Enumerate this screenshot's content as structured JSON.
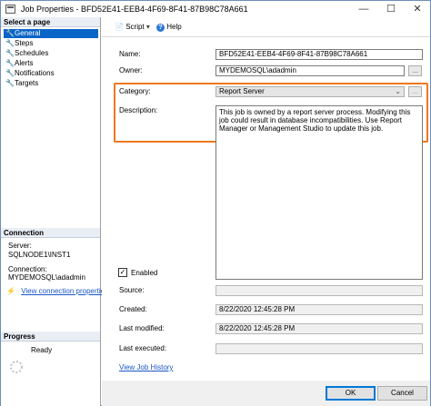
{
  "window": {
    "title": "Job Properties - BFD52E41-EEB4-4F69-8F41-87B98C78A661",
    "minimize": "—",
    "maximize": "☐",
    "close": "✕"
  },
  "left_pane": {
    "select_page_header": "Select a page",
    "pages": [
      {
        "label": "General",
        "selected": true
      },
      {
        "label": "Steps",
        "selected": false
      },
      {
        "label": "Schedules",
        "selected": false
      },
      {
        "label": "Alerts",
        "selected": false
      },
      {
        "label": "Notifications",
        "selected": false
      },
      {
        "label": "Targets",
        "selected": false
      }
    ],
    "connection_header": "Connection",
    "server_label": "Server:",
    "server_value": "SQLNODE1\\INST1",
    "connection_label": "Connection:",
    "connection_value": "MYDEMOSQL\\adadmin",
    "view_connection_properties": "View connection properties",
    "progress_header": "Progress",
    "progress_status": "Ready"
  },
  "toolbar": {
    "script_label": "Script",
    "help_label": "Help"
  },
  "form": {
    "name_label": "Name:",
    "name_value": "BFD52E41-EEB4-4F69-8F41-87B98C78A661",
    "owner_label": "Owner:",
    "owner_value": "MYDEMOSQL\\adadmin",
    "category_label": "Category:",
    "category_value": "Report Server",
    "description_label": "Description:",
    "description_value": "This job is owned by a report server process. Modifying this job could result in database incompatibilities. Use Report Manager or Management Studio to update this job.",
    "enabled_label": "Enabled",
    "enabled_checked": true,
    "source_label": "Source:",
    "source_value": "",
    "created_label": "Created:",
    "created_value": "8/22/2020 12:45:28 PM",
    "last_modified_label": "Last modified:",
    "last_modified_value": "8/22/2020 12:45:28 PM",
    "last_executed_label": "Last executed:",
    "last_executed_value": "",
    "view_job_history": "View Job History",
    "ellipsis": "..."
  },
  "buttons": {
    "ok": "OK",
    "cancel": "Cancel"
  },
  "colors": {
    "highlight_box": "#f0781e",
    "selected_item": "#0a64c8",
    "link": "#1a56c8"
  }
}
